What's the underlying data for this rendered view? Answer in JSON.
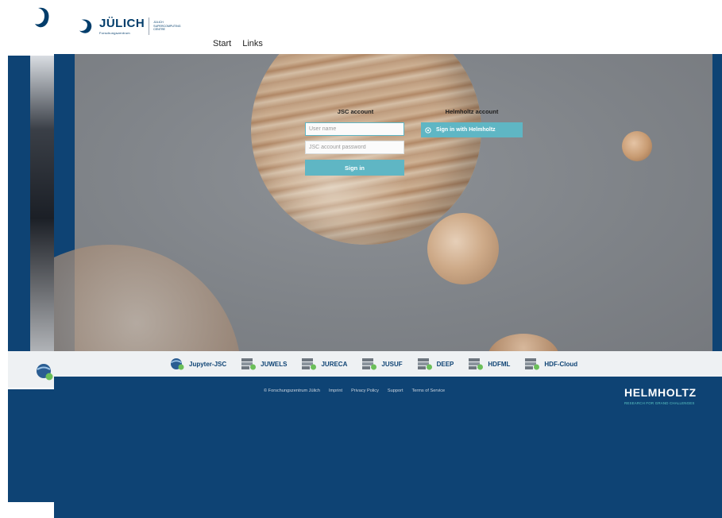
{
  "header": {
    "logo_word": "JÜLICH",
    "logo_sub": "Forschungszentrum",
    "logo_centre_lines": [
      "JÜLICH",
      "SUPERCOMPUTING",
      "CENTRE"
    ],
    "nav": [
      "Start",
      "Links"
    ]
  },
  "login": {
    "jsc_title": "JSC account",
    "username_placeholder": "User name",
    "password_placeholder": "JSC account password",
    "signin_label": "Sign in",
    "helmholtz_title": "Helmholtz account",
    "helmholtz_button_label": "Sign in with Helmholtz"
  },
  "services": [
    {
      "label": "Jupyter-JSC",
      "icon": "jupyter-jsc-icon"
    },
    {
      "label": "JUWELS",
      "icon": "server-icon"
    },
    {
      "label": "JURECA",
      "icon": "server-icon"
    },
    {
      "label": "JUSUF",
      "icon": "server-icon"
    },
    {
      "label": "DEEP",
      "icon": "server-icon"
    },
    {
      "label": "HDFML",
      "icon": "server-icon"
    },
    {
      "label": "HDF-Cloud",
      "icon": "server-icon"
    }
  ],
  "footer": {
    "copyright": "© Forschungszentrum Jülich",
    "links": [
      "Imprint",
      "Privacy Policy",
      "Support",
      "Terms of Service"
    ],
    "helmholtz_word": "HELMHOLTZ",
    "helmholtz_tagline": "RESEARCH FOR GRAND CHALLENGES"
  },
  "colors": {
    "brand_blue": "#0e4374",
    "accent_teal": "#5fb6c4",
    "service_bar": "#eef1f3"
  }
}
